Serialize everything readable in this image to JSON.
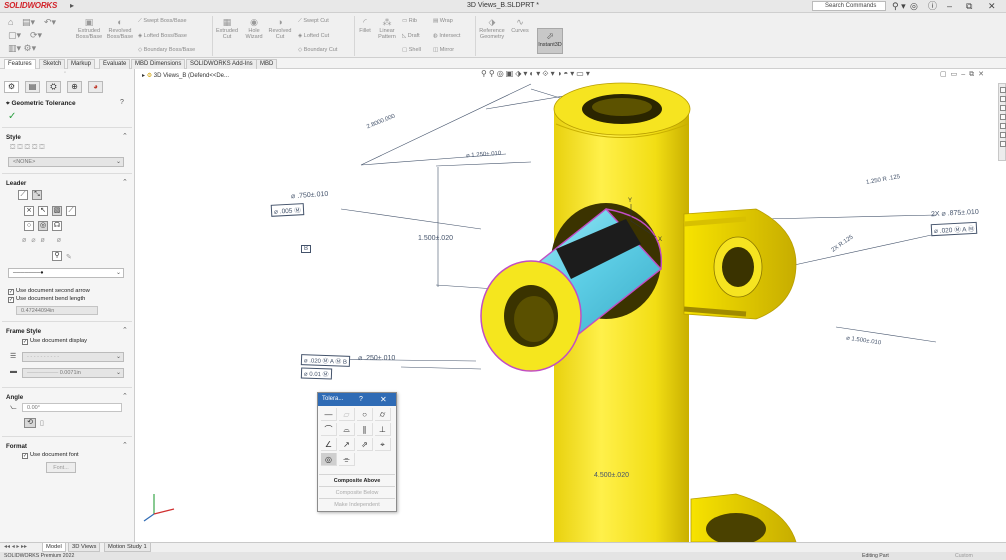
{
  "app": {
    "brand": "SOLIDWORKS",
    "document_title": "3D Views_B.SLDPRT *"
  },
  "search": {
    "placeholder": "Search Commands"
  },
  "colors": {
    "accent": "#2f6bb5",
    "part": "#f5e61e",
    "inner": "#6fd3e8",
    "brand": "#d2232a"
  },
  "ribbon": {
    "items": [
      {
        "label": "Extruded Boss/Base",
        "icon": "extrude-boss-icon"
      },
      {
        "label": "Revolved Boss/Base",
        "icon": "revolve-boss-icon"
      },
      {
        "label": "Swept Boss/Base",
        "icon": "swept-boss-icon"
      },
      {
        "label": "Lofted Boss/Base",
        "icon": "lofted-boss-icon"
      },
      {
        "label": "Boundary Boss/Base",
        "icon": "boundary-boss-icon"
      },
      {
        "label": "Extruded Cut",
        "icon": "extrude-cut-icon"
      },
      {
        "label": "Hole Wizard",
        "icon": "hole-wizard-icon"
      },
      {
        "label": "Revolved Cut",
        "icon": "revolve-cut-icon"
      },
      {
        "label": "Swept Cut",
        "icon": "swept-cut-icon"
      },
      {
        "label": "Lofted Cut",
        "icon": "lofted-cut-icon"
      },
      {
        "label": "Boundary Cut",
        "icon": "boundary-cut-icon"
      },
      {
        "label": "Fillet",
        "icon": "fillet-icon"
      },
      {
        "label": "Linear Pattern",
        "icon": "linear-pattern-icon"
      },
      {
        "label": "Rib",
        "icon": "rib-icon"
      },
      {
        "label": "Draft",
        "icon": "draft-icon"
      },
      {
        "label": "Shell",
        "icon": "shell-icon"
      },
      {
        "label": "Wrap",
        "icon": "wrap-icon"
      },
      {
        "label": "Intersect",
        "icon": "intersect-icon"
      },
      {
        "label": "Mirror",
        "icon": "mirror-icon"
      },
      {
        "label": "Reference Geometry",
        "icon": "reference-geometry-icon"
      },
      {
        "label": "Curves",
        "icon": "curves-icon"
      },
      {
        "label": "Instant3D",
        "icon": "instant3d-icon"
      }
    ]
  },
  "tabs": [
    "Features",
    "Sketch",
    "Markup",
    "Evaluate",
    "MBD Dimensions",
    "SOLIDWORKS Add-Ins",
    "MBD"
  ],
  "tree_flyout": {
    "label": "3D Views_B (Defend<<De..."
  },
  "property_manager": {
    "title": "Geometric Tolerance",
    "style": {
      "header": "Style",
      "select_value": "<NONE>"
    },
    "leader": {
      "header": "Leader",
      "second_arrow": "Use document second arrow",
      "bend_length": "Use document bend length",
      "bend_value": "0.47244094in"
    },
    "frame_style": {
      "header": "Frame Style",
      "use_display": "Use document display",
      "thickness_value": "0.0071in"
    },
    "angle": {
      "header": "Angle",
      "value": "0.00°"
    },
    "format": {
      "header": "Format",
      "use_font": "Use document font",
      "font_button": "Font..."
    }
  },
  "annotations": {
    "top_tolerance": "⌀ .750±.010",
    "top_frame": "⌀ .005 Ⓜ",
    "datum_b": "B",
    "vertical_dim": "1.500±.020",
    "lower_dim": "⌀ .250±.010",
    "lower_frame_1": "⌀ .020 Ⓜ A Ⓜ B",
    "lower_frame_2": "⌀ 0.01 Ⓜ",
    "right_tolerance": "2X ⌀ .875±.010",
    "right_frame": "⌀ .020 Ⓜ A Ⓜ",
    "bottom_dim": "4.500±.020",
    "top_left_dim": "2.8000.000",
    "top_right_dim": "⌀ 1.250±.010",
    "right_upper": "1.250 R .125",
    "right_mid": "⌀ 1.500±.010",
    "right_side": "2X R.125"
  },
  "tolerance_popup": {
    "title": "Tolera...",
    "symbols": [
      {
        "glyph": "—",
        "name": "straightness-icon"
      },
      {
        "glyph": "▱",
        "name": "flatness-icon"
      },
      {
        "glyph": "○",
        "name": "circularity-icon"
      },
      {
        "glyph": "⌭",
        "name": "cylindricity-icon"
      },
      {
        "glyph": "⌒",
        "name": "profile-line-icon"
      },
      {
        "glyph": "⌓",
        "name": "profile-surface-icon"
      },
      {
        "glyph": "∥",
        "name": "parallelism-icon"
      },
      {
        "glyph": "⊥",
        "name": "perpendicularity-icon"
      },
      {
        "glyph": "∠",
        "name": "angularity-icon"
      },
      {
        "glyph": "↗",
        "name": "circular-runout-icon"
      },
      {
        "glyph": "⇗",
        "name": "total-runout-icon"
      },
      {
        "glyph": "⌖",
        "name": "position-icon"
      },
      {
        "glyph": "◎",
        "name": "concentricity-icon"
      },
      {
        "glyph": "⌯",
        "name": "symmetry-icon"
      }
    ],
    "commands": [
      "Composite Above",
      "Composite Below",
      "Make Independent"
    ]
  },
  "bottom_tabs": [
    "Model",
    "3D Views",
    "Motion Study 1"
  ],
  "status": {
    "left": "SOLIDWORKS Premium 2022",
    "mode": "Editing Part",
    "units": "Custom"
  }
}
